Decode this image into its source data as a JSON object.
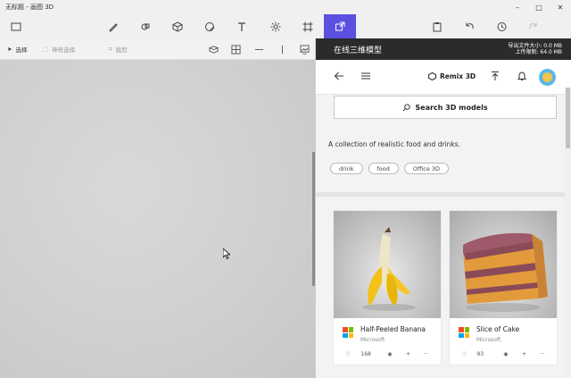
{
  "window": {
    "title": "无标题 - 画图 3D",
    "controls": [
      "–",
      "□",
      "✕"
    ]
  },
  "main_toolbar": {
    "active_index": 9,
    "buttons": [
      {
        "icon": "menu-icon"
      },
      {
        "icon": "brushes-icon"
      },
      {
        "icon": "2d-shapes-icon"
      },
      {
        "icon": "3d-shapes-icon"
      },
      {
        "icon": "stickers-icon"
      },
      {
        "icon": "text-icon"
      },
      {
        "icon": "effects-icon"
      },
      {
        "icon": "canvas-icon"
      },
      {
        "icon": "remix-3d-icon"
      },
      {
        "icon": "paste-icon"
      },
      {
        "icon": "undo-icon"
      },
      {
        "icon": "history-icon"
      },
      {
        "icon": "redo-icon"
      }
    ]
  },
  "canvas_tools": {
    "select_label": "选择",
    "magic_select_label": "神奇选择",
    "crop_label": "裁剪"
  },
  "remix_panel": {
    "title": "在线三维模型",
    "info_line1": "导出文件大小: 0.0 MB",
    "info_line2": "上传限制: 64.0 MB",
    "brand": "Remix 3D",
    "search_label": "Search 3D models",
    "description": "A collection of realistic food and drinks.",
    "tags": [
      "drink",
      "food",
      "Office 3D"
    ],
    "cards": [
      {
        "name": "Half-Peeled Banana",
        "author": "Microsoft",
        "likes": "168"
      },
      {
        "name": "Slice of Cake",
        "author": "Microsoft",
        "likes": "93"
      }
    ]
  },
  "colors": {
    "accent": "#5a4fe0",
    "panel_header": "#2b2b2b",
    "ms_red": "#f25022",
    "ms_green": "#7fba00",
    "ms_blue": "#00a4ef",
    "ms_yellow": "#ffb900"
  }
}
